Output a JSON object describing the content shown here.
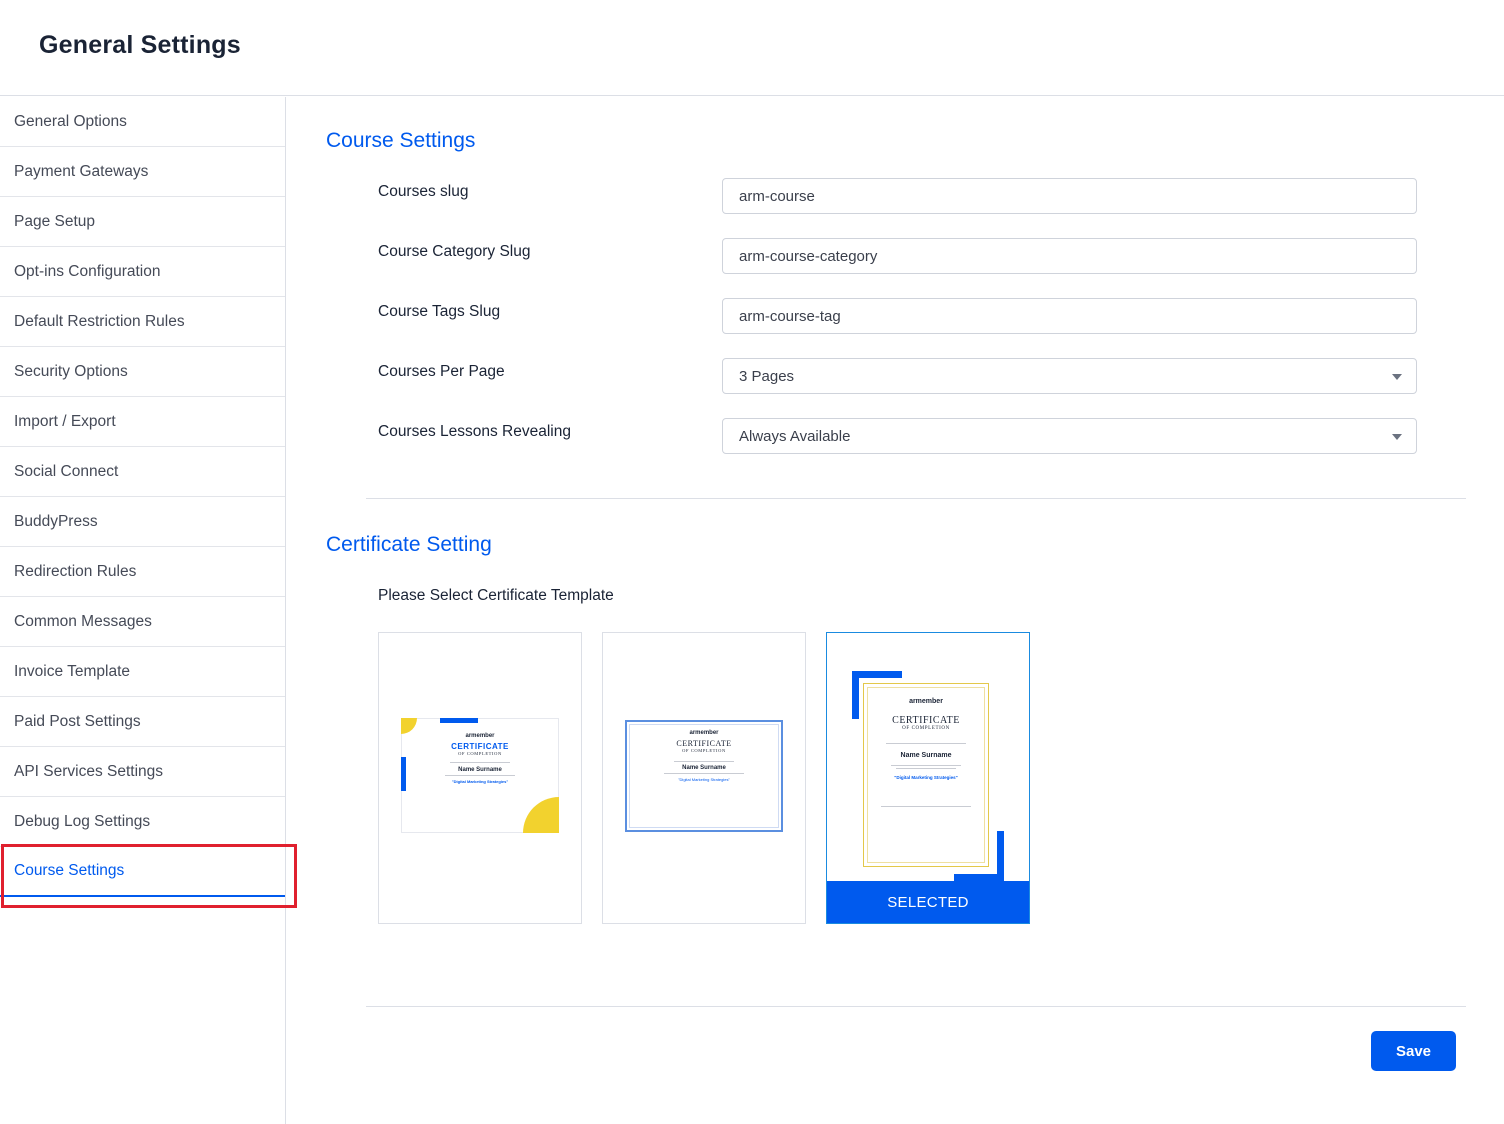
{
  "header": {
    "title": "General Settings"
  },
  "sidebar": {
    "items": [
      {
        "label": "General Options"
      },
      {
        "label": "Payment Gateways"
      },
      {
        "label": "Page Setup"
      },
      {
        "label": "Opt-ins Configuration"
      },
      {
        "label": "Default Restriction Rules"
      },
      {
        "label": "Security Options"
      },
      {
        "label": "Import / Export"
      },
      {
        "label": "Social Connect"
      },
      {
        "label": "BuddyPress"
      },
      {
        "label": "Redirection Rules"
      },
      {
        "label": "Common Messages"
      },
      {
        "label": "Invoice Template"
      },
      {
        "label": "Paid Post Settings"
      },
      {
        "label": "API Services Settings"
      },
      {
        "label": "Debug Log Settings"
      },
      {
        "label": "Course Settings"
      }
    ],
    "active_label": "Course Settings"
  },
  "course_settings": {
    "title": "Course Settings",
    "fields": {
      "courses_slug": {
        "label": "Courses slug",
        "value": "arm-course"
      },
      "category_slug": {
        "label": "Course Category Slug",
        "value": "arm-course-category"
      },
      "tags_slug": {
        "label": "Course Tags Slug",
        "value": "arm-course-tag"
      },
      "per_page": {
        "label": "Courses Per Page",
        "value": "3 Pages"
      },
      "lessons_revealing": {
        "label": "Courses Lessons Revealing",
        "value": "Always Available"
      }
    }
  },
  "certificate_setting": {
    "title": "Certificate Setting",
    "prompt": "Please Select Certificate Template",
    "selected_label": "SELECTED",
    "preview": {
      "brand": "armember",
      "cert_title": "CERTIFICATE",
      "cert_subtitle": "OF COMPLETION",
      "recipient": "Name Surname",
      "course": "\"Digital Marketing Strategies\""
    },
    "selected_index": 2
  },
  "actions": {
    "save_label": "Save"
  },
  "colors": {
    "accent": "#005aee",
    "highlight": "#e0202e",
    "yellow": "#f2d22e"
  }
}
